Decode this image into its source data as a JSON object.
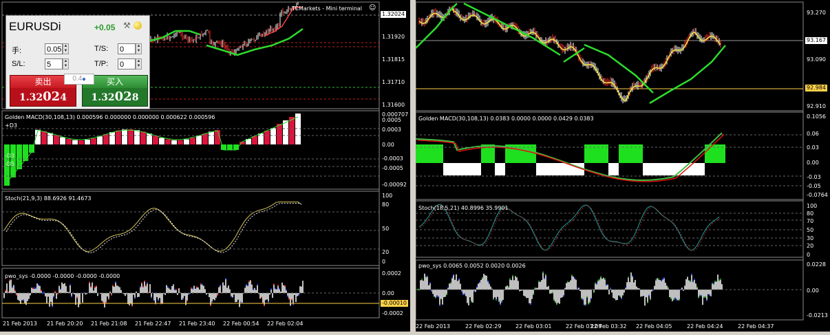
{
  "colors": {
    "up": "#ffffff",
    "down": "#ff0000",
    "ma": "#2ddc2d",
    "macd_red": "#dc143c",
    "macd_green": "#1fe01f",
    "stoch": "#d8c45a",
    "priceline": "#ffd24a"
  },
  "left": {
    "title": "TCMarkets - Mini terminal",
    "price_axis": [
      "1.32024",
      "1.31920",
      "1.31815",
      "1.31710",
      "1.31600"
    ],
    "macd": {
      "label": "Golden MACD(30,108,13) 0.000596 0.000000 0.000000 0.000622 0.000596",
      "plus_label": "+D3",
      "minus3": "-D3",
      "minus5": "-D5",
      "axis": [
        "0.000707",
        "0.0005",
        "0.0003",
        "0.00",
        "-0.0003",
        "-0.0005",
        "-0.00092"
      ]
    },
    "stoch": {
      "label": "Stoch(21,9,3) 88.6926 91.4673",
      "axis": [
        "100",
        "80",
        "50",
        "20",
        "0"
      ]
    },
    "pwo": {
      "label": "pwo_sys -0.0000 -0.0000 -0.0000 -0.0000",
      "axis": [
        "0.0002",
        "0.00",
        "-0.00010",
        "-0.0002"
      ]
    },
    "time_axis": [
      "21 Feb 2013",
      "21 Feb 20:20",
      "21 Feb 21:08",
      "21 Feb 22:47",
      "21 Feb 23:40",
      "22 Feb 00:54",
      "22 Feb 02:04"
    ]
  },
  "right": {
    "price_axis": [
      "93.270",
      "93.167",
      "93.090",
      "92.984",
      "92.910"
    ],
    "macd": {
      "label": "Golden MACD(30,108,13) 0.0383 0.0000 0.0000 0.0429 0.0383",
      "axis": [
        "0.1056",
        "0.06",
        "0.03",
        "0.00",
        "-0.03",
        "-0.05",
        "-0.0764"
      ]
    },
    "stoch": {
      "label": "Stoch(18,5,21) 40.8996 35.9901",
      "axis": [
        "100",
        "80",
        "70",
        "50",
        "30",
        "20",
        "0"
      ]
    },
    "pwo": {
      "label": "pwo_sys 0.0065 0.0052 0.0020 0.0026",
      "axis": [
        "0.0228",
        "0.00",
        "-0.0213"
      ]
    },
    "time_axis": [
      "22 Feb 2013",
      "22 Feb 02:29",
      "22 Feb 03:01",
      "22 Feb 03:09",
      "22 Feb 03:32",
      "22 Feb 04:05",
      "22 Feb 04:24",
      "22 Feb 04:37"
    ]
  },
  "mini_terminal": {
    "symbol": "EURUSDi",
    "change": "+0.05",
    "lots_label": "手:",
    "lots_value": "0.05",
    "ts_label": "T/S:",
    "ts_value": "0",
    "sl_label": "S/L:",
    "sl_value": "5",
    "tp_label": "T/P:",
    "tp_value": "0",
    "sell_label": "卖出",
    "sell_price_a": "1.32",
    "sell_price_b": "02",
    "sell_price_c": "4",
    "buy_label": "买入",
    "buy_price_a": "1.32",
    "buy_price_b": "02",
    "buy_price_c": "8",
    "spread": "0.4"
  }
}
